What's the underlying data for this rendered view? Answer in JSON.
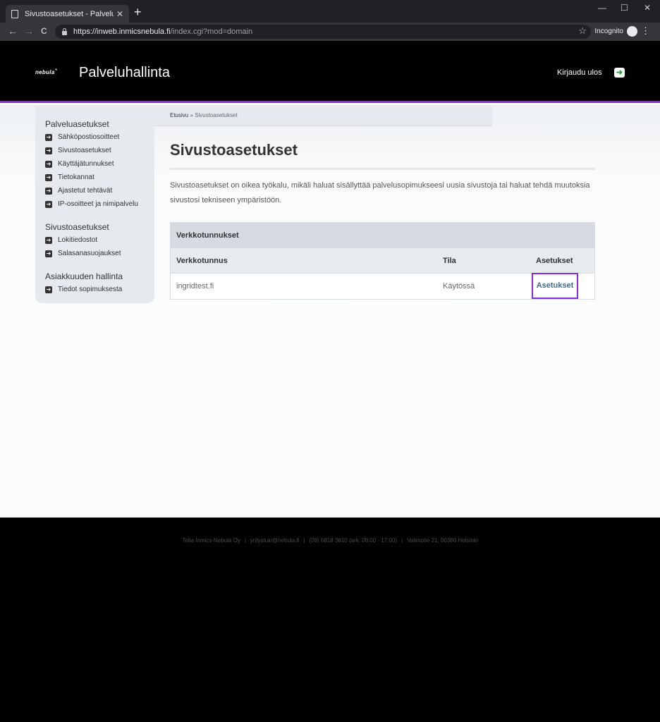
{
  "browser": {
    "tab_title": "Sivustoasetukset - Palveluhallinta",
    "tab_close": "✕",
    "new_tab": "+",
    "window_controls": [
      "—",
      "☐",
      "✕"
    ],
    "nav_icons": [
      "back-arrow-icon",
      "forward-arrow-icon",
      "reload-icon"
    ],
    "nav_glyphs": [
      "←",
      "→",
      "C"
    ],
    "url_main": "https://inweb.inmicsnebula.fi",
    "url_rest": "/index.cgi?mod=domain",
    "star": "☆",
    "incognito_label": "Incognito",
    "menu": "⋮"
  },
  "header": {
    "logo_text": "nebula",
    "logo_star": "*",
    "title": "Palveluhallinta",
    "logout_label": "Kirjaudu ulos",
    "logout_icon": "➜",
    "accent_color": "#8a2be2"
  },
  "sidebar": {
    "icon_glyph": "➜",
    "sections": [
      {
        "title": "Palveluasetukset",
        "items": [
          "Sähköpostiosoitteet",
          "Sivustoasetukset",
          "Käyttäjätunnukset",
          "Tietokannat",
          "Ajastetut tehtävät",
          "IP-osoitteet ja nimipalvelu"
        ]
      },
      {
        "title": "Sivustoasetukset",
        "items": [
          "Lokitiedostot",
          "Salasanasuojaukset"
        ]
      },
      {
        "title": "Asiakkuuden hallinta",
        "items": [
          "Tiedot sopimuksesta"
        ]
      }
    ]
  },
  "breadcrumb": {
    "home": "Etusivu",
    "separator": " » ",
    "current": "Sivustoasetukset"
  },
  "main": {
    "title": "Sivustoasetukset",
    "intro": "Sivustoasetukset on oikea työkalu, mikäli haluat sisällyttää palvelusopimukseesi uusia sivustoja tai haluat tehdä muutoksia sivustosi tekniseen ympäristöön.",
    "table": {
      "caption": "Verkkotunnukset",
      "headers": [
        "Verkkotunnus",
        "Tila",
        "Asetukset"
      ],
      "rows": [
        {
          "domain": "ingridtest.fi",
          "status": "Käytössä",
          "action": "Asetukset"
        }
      ]
    }
  },
  "footer": {
    "company": "Telia Inmics-Nebula Oy",
    "email": "yritystuki@nebula.fi",
    "phone": "(09) 6818 3810 (ark. 08:00 - 17:00)",
    "address": "Valimotie 21, 00380 Helsinki",
    "separator": "|"
  }
}
